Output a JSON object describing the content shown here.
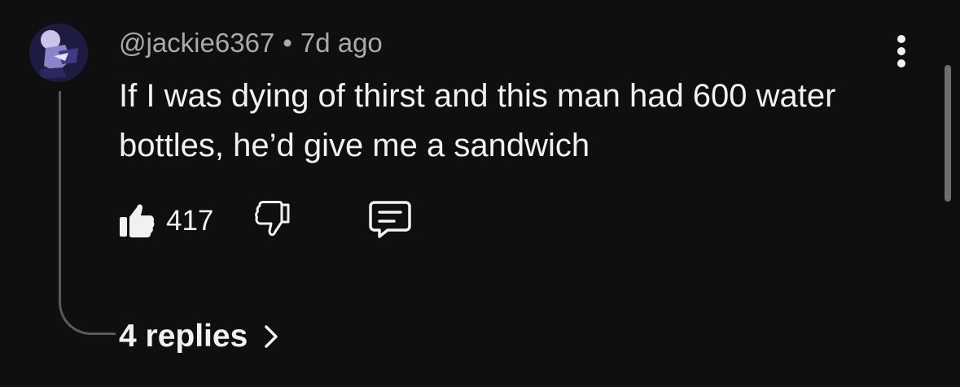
{
  "comment": {
    "username": "@jackie6367",
    "separator": "•",
    "timestamp": "7d ago",
    "text": "If I was dying of thirst and this man had 600 water bottles, he’d give me a sandwich",
    "like_count": "417",
    "replies_label": "4 replies"
  },
  "icons": {
    "like": "thumbs-up-icon",
    "dislike": "thumbs-down-icon",
    "reply": "comment-icon",
    "more": "more-vert-icon",
    "chevron": "chevron-right-icon"
  },
  "colors": {
    "background": "#0f0f0f",
    "primary_text": "#f1f1f1",
    "secondary_text": "#aaaaaa",
    "thread_line": "#5a5a5a"
  }
}
